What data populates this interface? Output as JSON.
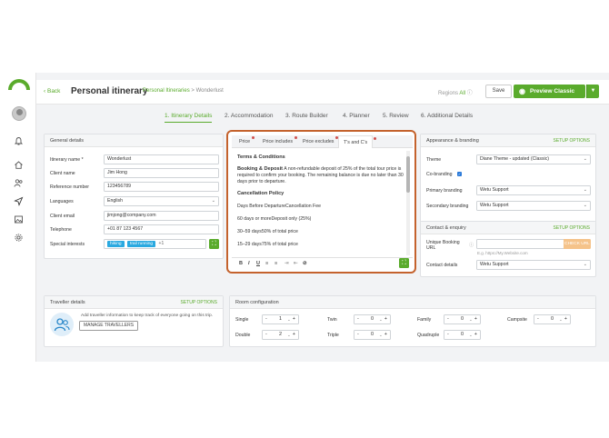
{
  "header": {
    "back_label": "Back",
    "title": "Personal itinerary",
    "breadcrumb_link": "Personal Itineraries",
    "breadcrumb_separator": ">",
    "breadcrumb_current": "Wonderlust",
    "regions_label": "Regions",
    "regions_value": "All",
    "save_label": "Save",
    "preview_label": "Preview Classic"
  },
  "steps": [
    {
      "label": "1. Itinerary Details",
      "active": true
    },
    {
      "label": "2. Accommodation"
    },
    {
      "label": "3. Route Builder"
    },
    {
      "label": "4. Planner"
    },
    {
      "label": "5. Review"
    },
    {
      "label": "6. Additional Details"
    }
  ],
  "general": {
    "title": "General details",
    "fields": [
      {
        "label": "Itinerary name *",
        "value": "Wonderlust"
      },
      {
        "label": "Client name",
        "value": "Jim Hong"
      },
      {
        "label": "Reference number",
        "value": "123456789"
      },
      {
        "label": "Languages",
        "value": "English"
      },
      {
        "label": "Client email",
        "value": "jimjong@company.com"
      },
      {
        "label": "Telephone",
        "value": "+01 87 123 4567"
      }
    ],
    "interests_label": "Special interests",
    "interests": [
      "hiking",
      "trail running"
    ],
    "interests_more": "+1"
  },
  "terms": {
    "tabs": [
      "Price",
      "Price includes",
      "Price excludes",
      "T's and C's"
    ],
    "heading": "Terms & Conditions",
    "deposit_bold": "Booking & Deposit",
    "deposit_text": "A non-refundable deposit of 25% of the total tour price is required to confirm your booking. The remaining balance is due no later than 30 days prior to departure.",
    "cancel_heading": "Cancellation Policy",
    "lines": [
      "Days Before DepartureCancellation Fee",
      "60 days or moreDeposit only (25%)",
      "30–59 days50% of total price",
      "15–29 days75% of total price"
    ],
    "toolbar": [
      "B",
      "I",
      "U"
    ]
  },
  "appearance": {
    "title": "Appearance & branding",
    "setup": "SETUP OPTIONS",
    "theme_label": "Theme",
    "theme_value": "Diane Theme - updated (Classic)",
    "cobranding_label": "Co-branding",
    "primary_label": "Primary branding",
    "primary_value": "Wetu Support",
    "secondary_label": "Secondary branding",
    "secondary_value": "Wetu Support"
  },
  "contact": {
    "title": "Contact & enquiry",
    "setup": "SETUP OPTIONS",
    "url_label_1": "Unique Booking",
    "url_label_2": "URL",
    "check_label": "CHECK URL",
    "url_hint": "E.g. https://My.Website.com",
    "details_label": "Contact details",
    "details_value": "Wetu Support"
  },
  "traveller": {
    "title": "Traveller details",
    "setup": "SETUP OPTIONS",
    "text": "Add traveller information to keep track of everyone going on this trip.",
    "manage_label": "MANAGE TRAVELLERS"
  },
  "rooms": {
    "title": "Room configuration",
    "items": [
      {
        "label": "Single",
        "value": "1"
      },
      {
        "label": "Twin",
        "value": "0"
      },
      {
        "label": "Family",
        "value": "0"
      },
      {
        "label": "Campsite",
        "value": "0"
      },
      {
        "label": "Double",
        "value": "2"
      },
      {
        "label": "Triple",
        "value": "0"
      },
      {
        "label": "Quadruple",
        "value": "0"
      }
    ]
  },
  "colors": {
    "accent": "#5aab2c",
    "highlight": "#c4622d",
    "tag": "#2aa9e0"
  }
}
